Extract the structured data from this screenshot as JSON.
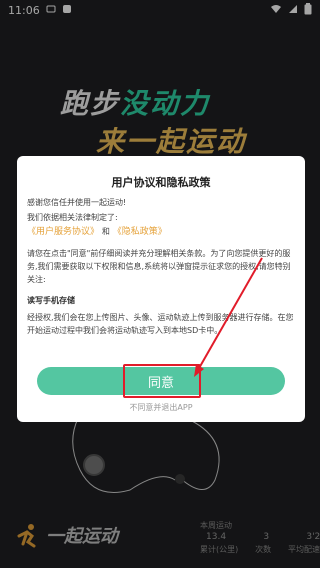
{
  "status_bar": {
    "time": "11:06"
  },
  "background": {
    "slogan_line1_part1": "跑步",
    "slogan_line1_part2": "没动力",
    "slogan_line2": "来一起运动"
  },
  "dialog": {
    "title": "用户协议和隐私政策",
    "greeting": "感谢您信任并使用一起运动!",
    "intro": "我们依据相关法律制定了:",
    "user_agreement_link": "《用户服务协议》",
    "and_text": "和",
    "privacy_policy_link": "《隐私政策》",
    "paragraph": "请您在点击\"同意\"前仔细阅读并充分理解相关条款。为了向您提供更好的服务,我们需要获取以下权限和信息,系统将以弹窗提示征求您的授权,请您特别关注:",
    "permission_title": "读写手机存储",
    "permission_desc": "经授权,我们会在您上传图片、头像、运动轨迹上传到服务器进行存储。在您开始运动过程中我们会将运动轨迹写入到本地SD卡中。",
    "agree_label": "同意",
    "exit_label": "不同意并退出APP"
  },
  "bottom": {
    "logo_text": "一起运动",
    "stats_label": "本周运动",
    "values": [
      "13.4",
      "3",
      "3'21"
    ],
    "units": [
      "累计(公里)",
      "次数",
      "平均配速"
    ]
  },
  "colors": {
    "accent_green": "#54c6a1",
    "link_orange": "#e5a23a",
    "highlight_red": "#e11c2a"
  }
}
